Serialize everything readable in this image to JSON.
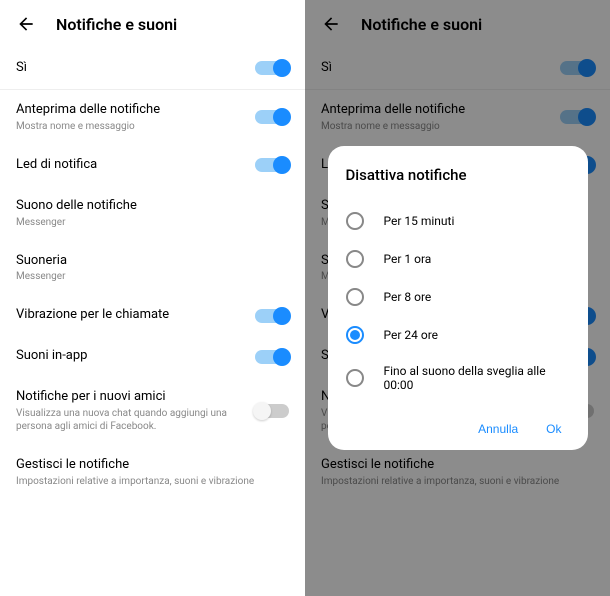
{
  "header": {
    "title": "Notifiche e suoni"
  },
  "rows": {
    "master": {
      "title": "Sì"
    },
    "preview": {
      "title": "Anteprima delle notifiche",
      "sub": "Mostra nome e messaggio"
    },
    "led": {
      "title": "Led di notifica"
    },
    "sound": {
      "title": "Suono delle notifiche",
      "sub": "Messenger"
    },
    "ringtone": {
      "title": "Suoneria",
      "sub": "Messenger"
    },
    "vibrate": {
      "title": "Vibrazione per le chiamate"
    },
    "inapp": {
      "title": "Suoni in-app"
    },
    "newfriends": {
      "title": "Notifiche per i nuovi amici",
      "sub": "Visualizza una nuova chat quando aggiungi una persona agli amici di Facebook."
    },
    "manage": {
      "title": "Gestisci le notifiche",
      "sub": "Impostazioni relative a importanza, suoni e vibrazione"
    }
  },
  "dialog": {
    "title": "Disattiva notifiche",
    "options": {
      "o0": "Per 15 minuti",
      "o1": "Per 1 ora",
      "o2": "Per 8 ore",
      "o3": "Per 24 ore",
      "o4": "Fino al suono della sveglia alle 00:00"
    },
    "cancel": "Annulla",
    "ok": "Ok"
  }
}
